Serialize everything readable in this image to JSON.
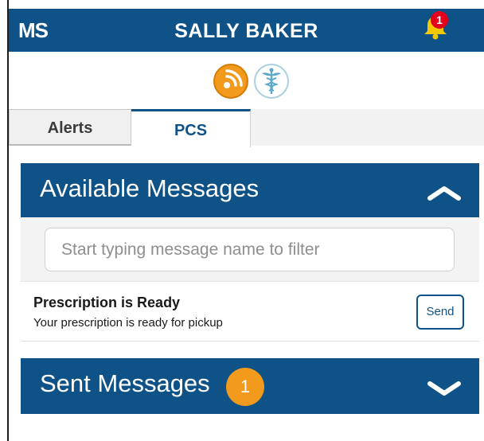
{
  "header": {
    "logo_text": "MS",
    "user_name": "SALLY BAKER",
    "notification_count": "1",
    "bell_color": "#f6c800",
    "badge_color": "#e3001b"
  },
  "icons": [
    {
      "name": "broadcast-icon",
      "color": "#f29a1c"
    },
    {
      "name": "caduceus-icon",
      "color": "#5ba8c9"
    }
  ],
  "tabs": [
    {
      "label": "Alerts",
      "active": false
    },
    {
      "label": "PCS",
      "active": true
    }
  ],
  "available": {
    "title": "Available Messages",
    "expanded": true,
    "filter_placeholder": "Start typing message name to filter",
    "messages": [
      {
        "title": "Prescription is Ready",
        "description": "Your prescription is ready for pickup",
        "action": "Send"
      }
    ]
  },
  "sent": {
    "title": "Sent Messages",
    "count": "1",
    "expanded": false
  },
  "colors": {
    "primary": "#0f5287",
    "accent": "#f29a1c"
  }
}
